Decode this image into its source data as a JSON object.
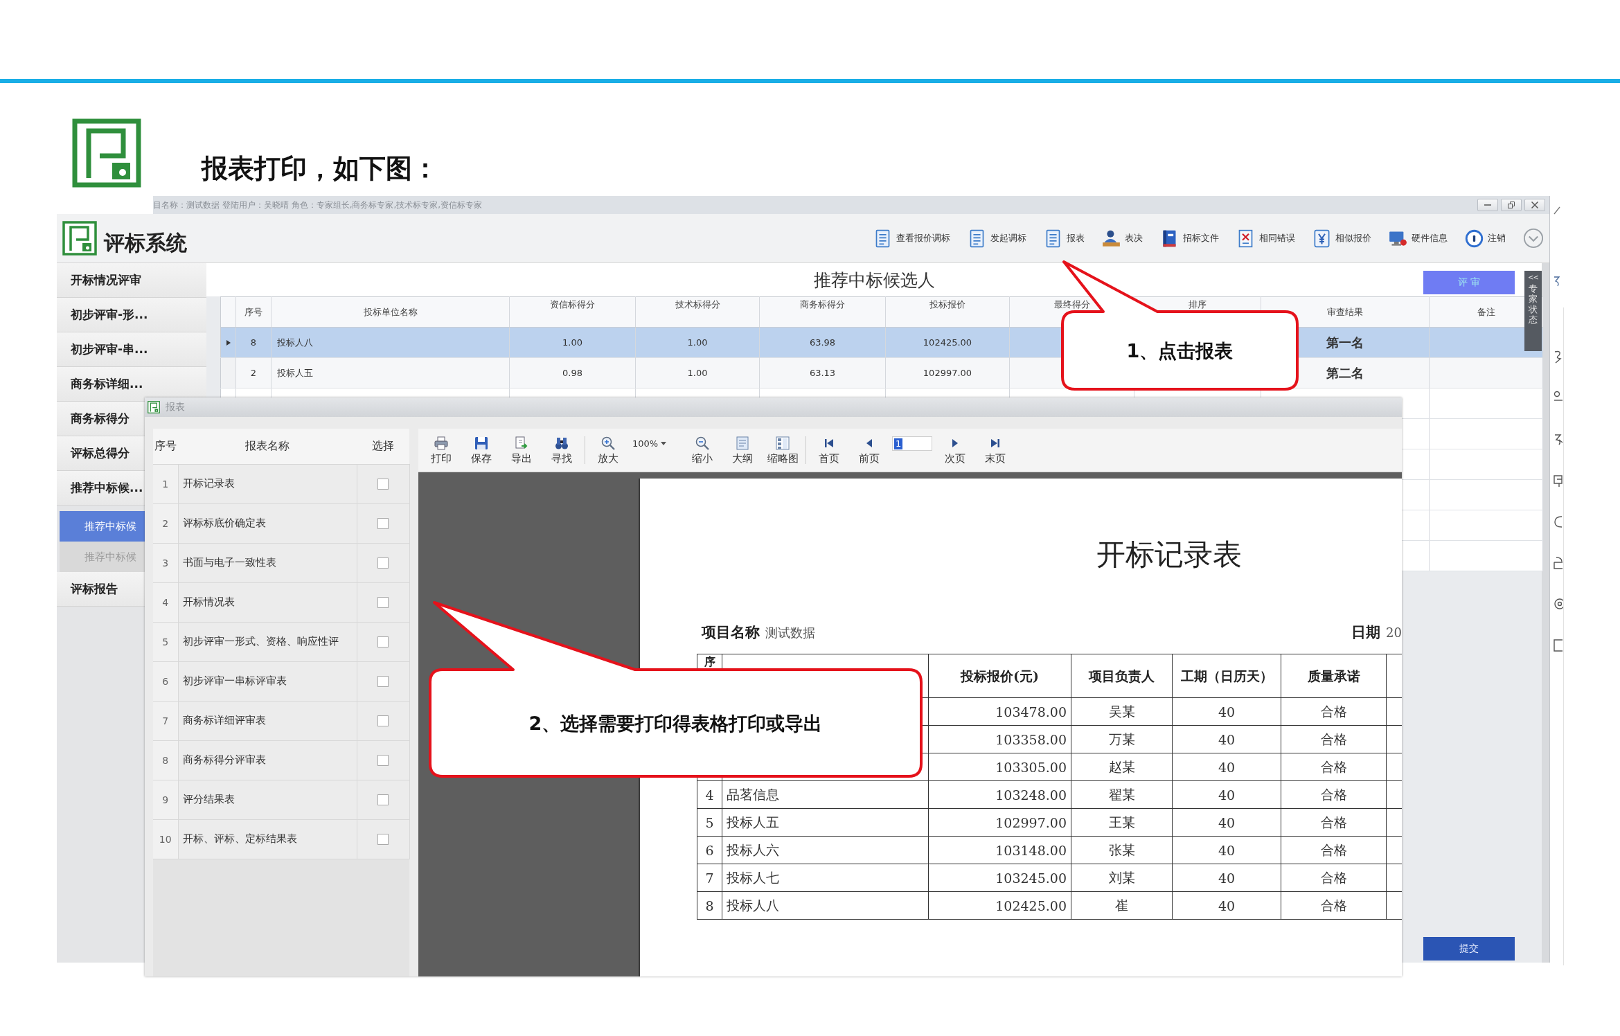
{
  "slide": {
    "title": "报表打印，如下图："
  },
  "app": {
    "title_bar": "目名称：测试数据 登陆用户：吴晓晴 角色：专家组长,商务标专家,技术标专家,资信标专家",
    "brand": "评标系统",
    "toolbar": [
      {
        "kind": "doc",
        "label": "查看报价调标"
      },
      {
        "kind": "doc",
        "label": "发起调标"
      },
      {
        "kind": "doc",
        "label": "报表"
      },
      {
        "kind": "vote",
        "label": "表决"
      },
      {
        "kind": "book",
        "label": "招标文件"
      },
      {
        "kind": "error",
        "label": "相同错误"
      },
      {
        "kind": "yen",
        "label": "相似报价"
      },
      {
        "kind": "hardware",
        "label": "硬件信息"
      },
      {
        "kind": "logout",
        "label": "注销"
      }
    ],
    "sidebar": {
      "items": [
        {
          "label": "开标情况评审"
        },
        {
          "label": "初步评审-形..."
        },
        {
          "label": "初步评审-串..."
        },
        {
          "label": "商务标详细..."
        },
        {
          "label": "商务标得分"
        },
        {
          "label": "评标总得分"
        },
        {
          "label": "推荐中标候...",
          "children": [
            {
              "label": "推荐中标候",
              "selected": true
            },
            {
              "label": "推荐中标候",
              "selected": false
            }
          ]
        },
        {
          "label": "评标报告"
        }
      ]
    },
    "content": {
      "title": "推荐中标候选人",
      "action_button": "评 审",
      "side_tab": {
        "arrow": "<<",
        "label": "专家状态"
      },
      "table": {
        "columns": {
          "seq": "序号",
          "bidder": "投标单位名称",
          "credit_score": "资信标得分",
          "tech_score": "技术标得分",
          "business_score": "商务标得分",
          "bid_price": "投标报价",
          "final_score": "最终得分",
          "rank": "排序",
          "review_result": "审查结果",
          "remark": "备注"
        },
        "rows": [
          {
            "selected": true,
            "seq": "8",
            "bidder": "投标人八",
            "credit_score": "1.00",
            "tech_score": "1.00",
            "business_score": "63.98",
            "bid_price": "102425.00",
            "review_result": "第一名"
          },
          {
            "selected": false,
            "seq": "2",
            "bidder": "投标人五",
            "credit_score": "0.98",
            "tech_score": "1.00",
            "business_score": "63.13",
            "bid_price": "102997.00",
            "review_result": "第二名"
          }
        ]
      },
      "submit_button": "提交"
    }
  },
  "report_window": {
    "title": "报表",
    "list": {
      "columns": [
        "序号",
        "报表名称",
        "选择"
      ],
      "rows": [
        {
          "index": "1",
          "name": "开标记录表",
          "checked": false
        },
        {
          "index": "2",
          "name": "评标标底价确定表",
          "checked": false
        },
        {
          "index": "3",
          "name": "书面与电子一致性表",
          "checked": false
        },
        {
          "index": "4",
          "name": "开标情况表",
          "checked": false
        },
        {
          "index": "5",
          "name": "初步评审一形式、资格、响应性评",
          "checked": false
        },
        {
          "index": "6",
          "name": "初步评审一串标评审表",
          "checked": false
        },
        {
          "index": "7",
          "name": "商务标详细评审表",
          "checked": false
        },
        {
          "index": "8",
          "name": "商务标得分评审表",
          "checked": false
        },
        {
          "index": "9",
          "name": "评分结果表",
          "checked": false
        },
        {
          "index": "10",
          "name": "开标、评标、定标结果表",
          "checked": false
        }
      ]
    },
    "toolbar": [
      [
        {
          "kind": "print",
          "label": "打印"
        },
        {
          "kind": "save",
          "label": "保存"
        },
        {
          "kind": "export",
          "label": "导出"
        },
        {
          "kind": "find",
          "label": "寻找"
        }
      ],
      [
        {
          "kind": "zoom_in",
          "label": "放大"
        },
        {
          "kind": "zoom_select",
          "value": "100%"
        },
        {
          "kind": "zoom_out",
          "label": "缩小"
        },
        {
          "kind": "outline",
          "label": "大纲"
        },
        {
          "kind": "thumbnails",
          "label": "缩略图"
        }
      ],
      [
        {
          "kind": "first",
          "label": "首页"
        },
        {
          "kind": "prev",
          "label": "前页"
        },
        {
          "kind": "page_field",
          "value": "1"
        },
        {
          "kind": "next",
          "label": "次页"
        },
        {
          "kind": "last",
          "label": "末页"
        }
      ]
    ],
    "document": {
      "title": "开标记录表",
      "project_label": "项目名称",
      "project_value": "测试数据",
      "date_label": "日期",
      "date_value": "20",
      "table": {
        "columns": {
          "seq": "序",
          "price": "投标报价(元)",
          "manager": "项目负责人",
          "duration": "工期（日历天）",
          "quality": "质量承诺"
        },
        "rows": [
          {
            "price": "103478.00",
            "manager": "吴某",
            "duration": "40",
            "quality": "合格"
          },
          {
            "price": "103358.00",
            "manager": "万某",
            "duration": "40",
            "quality": "合格"
          },
          {
            "price": "103305.00",
            "manager": "赵某",
            "duration": "40",
            "quality": "合格"
          },
          {
            "seq": "4",
            "bidder": "品茗信息",
            "price": "103248.00",
            "manager": "翟某",
            "duration": "40",
            "quality": "合格"
          },
          {
            "seq": "5",
            "bidder": "投标人五",
            "price": "102997.00",
            "manager": "王某",
            "duration": "40",
            "quality": "合格"
          },
          {
            "seq": "6",
            "bidder": "投标人六",
            "price": "103148.00",
            "manager": "张某",
            "duration": "40",
            "quality": "合格"
          },
          {
            "seq": "7",
            "bidder": "投标人七",
            "price": "103245.00",
            "manager": "刘某",
            "duration": "40",
            "quality": "合格"
          },
          {
            "seq": "8",
            "bidder": "投标人八",
            "price": "102425.00",
            "manager": "崔",
            "duration": "40",
            "quality": "合格"
          }
        ]
      }
    }
  },
  "callouts": [
    {
      "text": "1、点击报表"
    },
    {
      "text": "2、选择需要打印得表格打印或导出"
    }
  ]
}
